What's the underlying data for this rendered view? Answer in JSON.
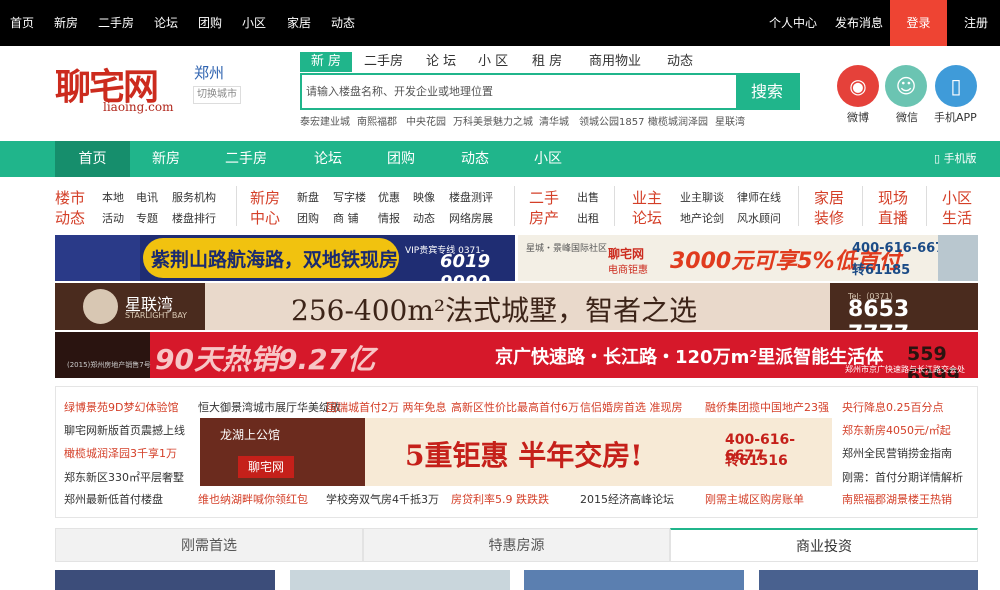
{
  "topbar": {
    "left_links": [
      "首页",
      "新房",
      "二手房",
      "论坛",
      "团购",
      "小区",
      "家居",
      "动态"
    ],
    "personal_center": "个人中心",
    "post_info": "发布消息",
    "login": "登录",
    "register": "注册"
  },
  "header": {
    "logo_cn": "聊宅网",
    "logo_en": "liaoing.com",
    "city": "郑州",
    "switch_city": "切换城市"
  },
  "search": {
    "tabs": [
      "新 房",
      "二手房",
      "论 坛",
      "小 区",
      "租 房",
      "商用物业",
      "动态"
    ],
    "placeholder": "请输入楼盘名称、开发企业或地理位置",
    "button": "搜索",
    "hot_keywords": [
      "泰宏建业城",
      "南熙福郡",
      "中央花园",
      "万科美景魅力之城",
      "清华城",
      "领城公园1857",
      "橄榄城润泽园",
      "星联湾"
    ]
  },
  "social": {
    "weibo": "微博",
    "weixin": "微信",
    "app": "手机APP"
  },
  "nav": {
    "items": [
      "首页",
      "新房",
      "二手房",
      "论坛",
      "团购",
      "动态",
      "小区"
    ],
    "mobile": "手机版"
  },
  "categories": {
    "c1_l1": "楼市",
    "c1_l2": "动态",
    "c1_sub": [
      "本地",
      "电讯",
      "服务机构",
      "活动",
      "专题",
      "楼盘排行"
    ],
    "c2_l1": "新房",
    "c2_l2": "中心",
    "c2_sub": [
      "新盘",
      "写字楼",
      "优惠",
      "映像",
      "楼盘测评",
      "团购",
      "商 铺",
      "情报",
      "动态",
      "网络房展"
    ],
    "c3_l1": "二手",
    "c3_l2": "房产",
    "c3_sub": [
      "出售",
      "出租"
    ],
    "c4_l1": "业主",
    "c4_l2": "论坛",
    "c4_sub": [
      "业主聊谈",
      "律师在线",
      "地产论剑",
      "风水顾问"
    ],
    "c5_l1": "家居",
    "c5_l2": "装修",
    "c6_l1": "现场",
    "c6_l2": "直播",
    "c7_l1": "小区",
    "c7_l2": "生活"
  },
  "banners": {
    "b1_title": "紫荆山路航海路，双地铁现房",
    "b1_hotline": "VIP贵宾专线 0371-",
    "b1_phone": "6019 9990",
    "b2_brand": "星城・景峰国际社区",
    "b2_site": "聊宅网",
    "b2_site_sub": "电商钜惠",
    "b2_offer": "3000元可享5%低首付",
    "b2_phone1": "400-616-6677",
    "b2_phone2": "转61185",
    "b3_name": "星联湾",
    "b3_name_en": "STARLIGHT BAY",
    "b3_title": "256-400m²法式城墅，智者之选",
    "b3_tel_label": "Tel:（0371）",
    "b3_tel": "8653 7777",
    "b4_left_note": "(2015)郑州房地产销售7号",
    "b4_big": "90天热销9.27亿",
    "b4_title": "京广快速路・长江路・120万m²里派智能生活体",
    "b4_phone": "559 6999",
    "b4_addr": "郑州市京广快速路与长江路交会处"
  },
  "news": {
    "left": [
      "绿博景苑9D梦幻体验馆",
      "聊宅网新版首页震撼上线",
      "橄榄城润泽园3千享1万",
      "郑东新区330㎡平层奢墅",
      "郑州最新低首付楼盘"
    ],
    "top": [
      "恒大御景湾城市展厅华美绽放",
      "国瑞城首付2万 两年免息",
      "高新区性价比最高首付6万",
      "信侣婚房首选 准现房",
      "融侨集团揽中国地产23强",
      "央行降息0.25百分点"
    ],
    "right": [
      "郑东新房4050元/㎡起",
      "郑州全民营销捞金指南",
      "刚需：首付分期详情解析"
    ],
    "bottom": [
      "维也纳湖畔喊你领红包",
      "学校旁双气房4千抵3万",
      "房贷利率5.9 跌跌跌",
      "2015经济高峰论坛",
      "刚需主城区购房账单",
      "南熙福郡湖景楼王热销"
    ]
  },
  "mid_ad": {
    "project": "龙湖上公馆",
    "logo": "聊宅网",
    "headline": "5重钜惠   半年交房!",
    "phone1": "400-616-6677",
    "phone2": "转61516"
  },
  "feature_tabs": [
    "刚需首选",
    "特惠房源",
    "商业投资"
  ]
}
